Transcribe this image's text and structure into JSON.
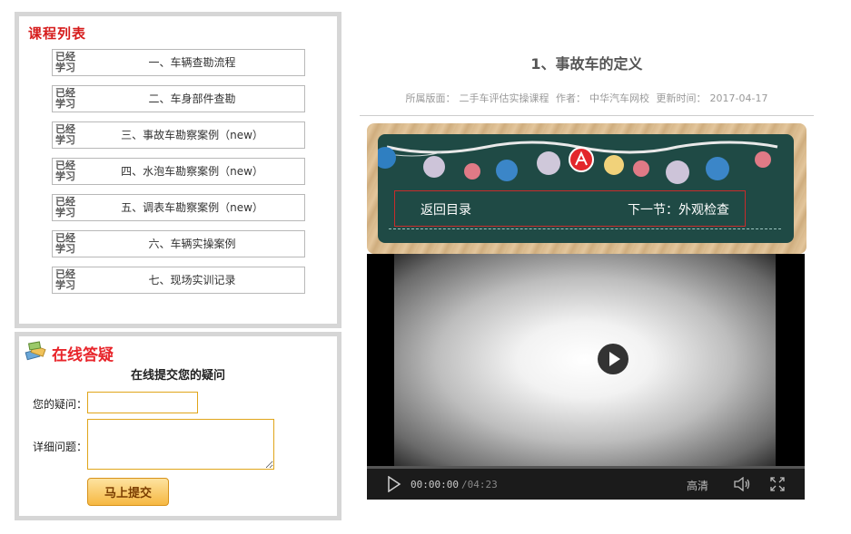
{
  "course_list": {
    "title": "课程列表",
    "lessons": [
      {
        "status": "已经学习",
        "title": "一、车辆查勘流程"
      },
      {
        "status": "已经学习",
        "title": "二、车身部件查勘"
      },
      {
        "status": "已经学习",
        "title": "三、事故车勘察案例（new）"
      },
      {
        "status": "已经学习",
        "title": "四、水泡车勘察案例（new）"
      },
      {
        "status": "已经学习",
        "title": "五、调表车勘察案例（new）"
      },
      {
        "status": "已经学习",
        "title": "六、车辆实操案例"
      },
      {
        "status": "已经学习",
        "title": "七、现场实训记录"
      }
    ]
  },
  "qa": {
    "title": "在线答疑",
    "subtitle": "在线提交您的疑问",
    "question_label": "您的疑问：",
    "question_value": "",
    "detail_label": "详细问题：",
    "detail_value": "",
    "submit_label": "马上提交"
  },
  "article": {
    "title": "1、事故车的定义",
    "section_label": "所属版面：",
    "section": "二手车评估实操课程",
    "author_label": "作者：",
    "author": "中华汽车网校",
    "updated_label": "更新时间：",
    "updated": "2017-04-17"
  },
  "banner": {
    "back_label": "返回目录",
    "next_label": "下一节：外观检查",
    "logo_icon": "brand-logo-icon",
    "colors": {
      "board": "#1f4a45",
      "frame_border": "#c92b2b"
    }
  },
  "player": {
    "current_time": "00:00:00",
    "duration": "/04:23",
    "quality": "高清",
    "progress": 0,
    "icons": [
      "play-icon",
      "volume-icon",
      "fullscreen-icon"
    ]
  }
}
